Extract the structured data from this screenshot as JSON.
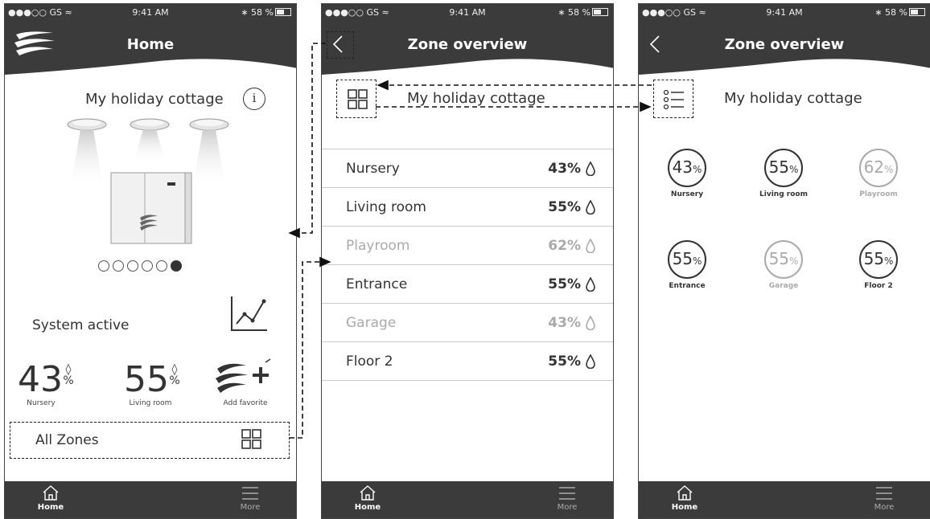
{
  "status": {
    "carrier": "●●●○○ GS",
    "time": "9:41 AM",
    "battery": "58 %"
  },
  "tabbar": {
    "home": "Home",
    "more": "More"
  },
  "home": {
    "title": "Home",
    "cottage": "My holiday cottage",
    "system_status": "System active",
    "carousel": {
      "total": 6,
      "active_index": 5
    },
    "favorites": [
      {
        "value": "43",
        "unit": "%",
        "label": "Nursery"
      },
      {
        "value": "55",
        "unit": "%",
        "label": "Living room"
      }
    ],
    "add_favorite": "Add favorite",
    "all_zones": "All Zones"
  },
  "zone_list": {
    "title": "Zone overview",
    "cottage": "My holiday cottage",
    "zones": [
      {
        "name": "Nursery",
        "value": "43%",
        "dim": false
      },
      {
        "name": "Living room",
        "value": "55%",
        "dim": false
      },
      {
        "name": "Playroom",
        "value": "62%",
        "dim": true
      },
      {
        "name": "Entrance",
        "value": "55%",
        "dim": false
      },
      {
        "name": "Garage",
        "value": "43%",
        "dim": true
      },
      {
        "name": "Floor 2",
        "value": "55%",
        "dim": false
      }
    ]
  },
  "zone_grid": {
    "title": "Zone overview",
    "cottage": "My holiday cottage",
    "zones": [
      {
        "value": "43",
        "unit": "%",
        "name": "Nursery",
        "dim": false
      },
      {
        "value": "55",
        "unit": "%",
        "name": "Living room",
        "dim": false
      },
      {
        "value": "62",
        "unit": "%",
        "name": "Playroom",
        "dim": true
      },
      {
        "value": "55",
        "unit": "%",
        "name": "Entrance",
        "dim": false
      },
      {
        "value": "55",
        "unit": "%",
        "name": "Garage",
        "dim": true
      },
      {
        "value": "55",
        "unit": "%",
        "name": "Floor 2",
        "dim": false
      }
    ]
  },
  "colors": {
    "header": "#3b3b3b",
    "text": "#333333",
    "dim": "#aaaaaa"
  }
}
